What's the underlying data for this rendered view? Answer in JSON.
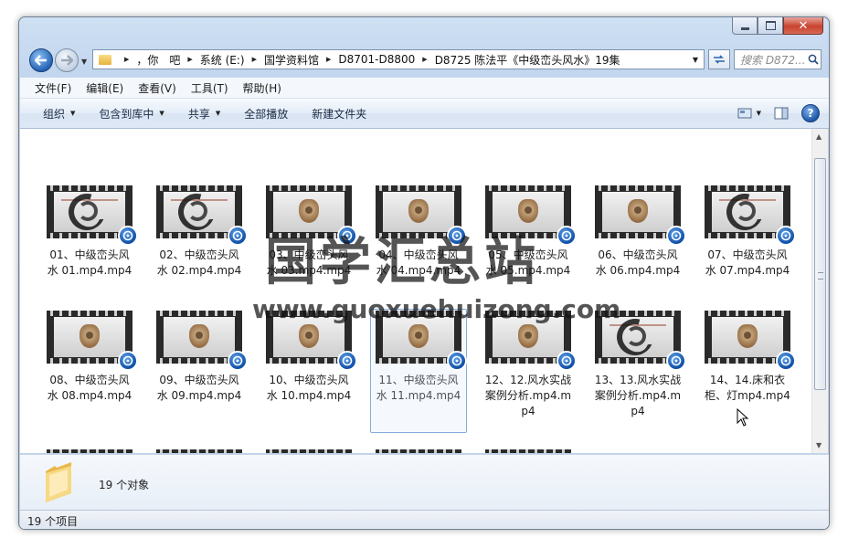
{
  "window": {
    "caption_buttons": [
      "minimize",
      "maximize",
      "close"
    ]
  },
  "address_bar": {
    "crumbs": [
      "，你　吧",
      "系统 (E:)",
      "国学资料馆",
      "D8701-D8800",
      "D8725 陈法平《中级峦头风水》19集"
    ]
  },
  "search": {
    "placeholder": "搜索 D872..."
  },
  "menu": [
    "文件(F)",
    "编辑(E)",
    "查看(V)",
    "工具(T)",
    "帮助(H)"
  ],
  "commands": [
    {
      "label": "组织",
      "dropdown": true
    },
    {
      "label": "包含到库中",
      "dropdown": true
    },
    {
      "label": "共享",
      "dropdown": true
    },
    {
      "label": "全部播放",
      "dropdown": false
    },
    {
      "label": "新建文件夹",
      "dropdown": false
    }
  ],
  "files": [
    {
      "name": "01、中级峦头风水 01.mp4.mp4",
      "thumb": "ink"
    },
    {
      "name": "02、中级峦头风水 02.mp4.mp4",
      "thumb": "ink"
    },
    {
      "name": "03、中级峦头风水 03.mp4.mp4",
      "thumb": "emblem"
    },
    {
      "name": "04、中级峦头风水 04.mp4.mp4",
      "thumb": "emblem"
    },
    {
      "name": "05、中级峦头风水 05.mp4.mp4",
      "thumb": "emblem"
    },
    {
      "name": "06、中级峦头风水 06.mp4.mp4",
      "thumb": "emblem"
    },
    {
      "name": "07、中级峦头风水 07.mp4.mp4",
      "thumb": "ink"
    },
    {
      "name": "08、中级峦头风水 08.mp4.mp4",
      "thumb": "emblem"
    },
    {
      "name": "09、中级峦头风水 09.mp4.mp4",
      "thumb": "emblem"
    },
    {
      "name": "10、中级峦头风水 10.mp4.mp4",
      "thumb": "emblem"
    },
    {
      "name": "11、中级峦头风水 11.mp4.mp4",
      "thumb": "emblem",
      "selected": true
    },
    {
      "name": "12、12.风水实战案例分析.mp4.mp4",
      "thumb": "emblem"
    },
    {
      "name": "13、13.风水实战案例分析.mp4.mp4",
      "thumb": "ink"
    },
    {
      "name": "14、14.床和衣柜、灯mp4.mp4",
      "thumb": "emblem"
    },
    {
      "name": "",
      "thumb": "emblem"
    },
    {
      "name": "",
      "thumb": "emblem"
    },
    {
      "name": "",
      "thumb": "ink"
    },
    {
      "name": "",
      "thumb": "emblem"
    },
    {
      "name": "",
      "thumb": "emblem"
    }
  ],
  "details": {
    "count_text": "19 个对象"
  },
  "status": {
    "text": "19 个项目"
  },
  "watermark": {
    "main": "国学汇总站",
    "url": "www.guoxuehuizong.com"
  }
}
